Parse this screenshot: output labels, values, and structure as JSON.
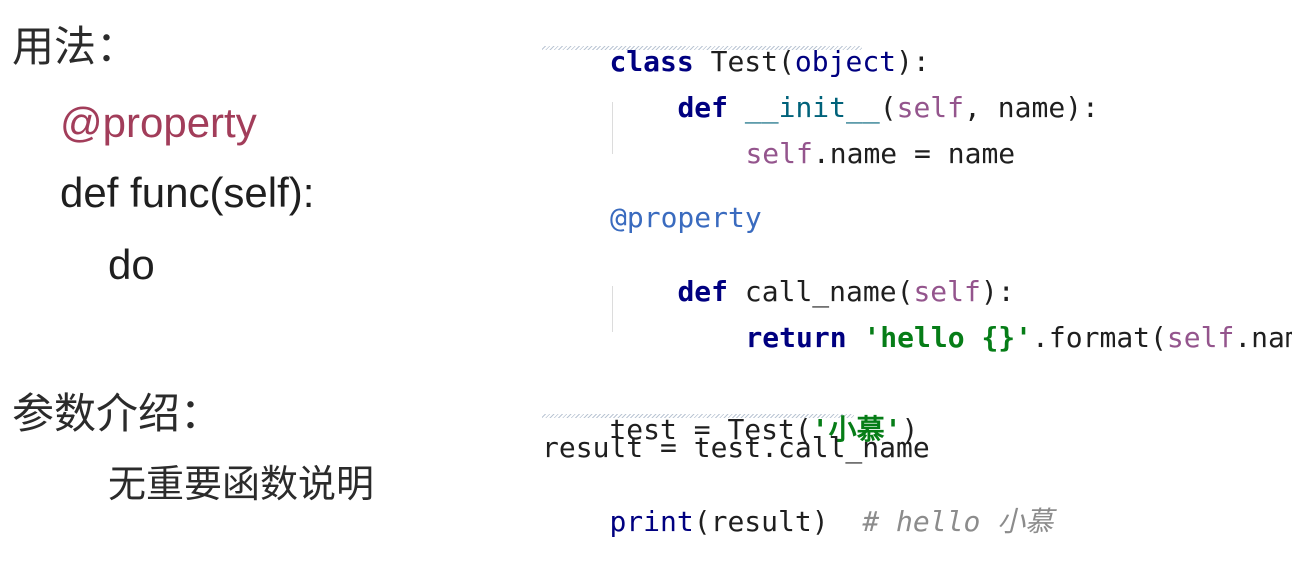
{
  "left_panel": {
    "usage_heading": "用法：",
    "decorator": "@property",
    "def_line": "def func(self):",
    "body_line": "do",
    "params_heading": "参数介绍：",
    "params_desc": "无重要函数说明"
  },
  "code": {
    "class_kw": "class",
    "class_rest": " Test(",
    "class_base": "object",
    "class_end": "):",
    "def1_kw": "def",
    "def1_name": "__init__",
    "def1_open": "(",
    "def1_self": "self",
    "def1_rest": ", name):",
    "assign_self": "self",
    "assign_rest": ".name = name",
    "decorator": "@property",
    "def2_kw": "def",
    "def2_name": " call_name(",
    "def2_self": "self",
    "def2_end": "):",
    "return_kw": "return",
    "return_str": " 'hello {}'",
    "return_mid": ".format(",
    "return_self": "self",
    "return_end": ".name)",
    "test_line_a": "test = Test(",
    "test_str": "'小慕'",
    "test_line_b": ")",
    "result_line": "result = test.call_name",
    "print_fn": "print",
    "print_rest": "(result)  ",
    "print_comment": "# hello 小慕"
  },
  "colors": {
    "decorator_text_left": "#a23d5a",
    "keyword": "#000080",
    "self": "#94558d",
    "string": "#067d17",
    "comment": "#8c8c8c"
  }
}
